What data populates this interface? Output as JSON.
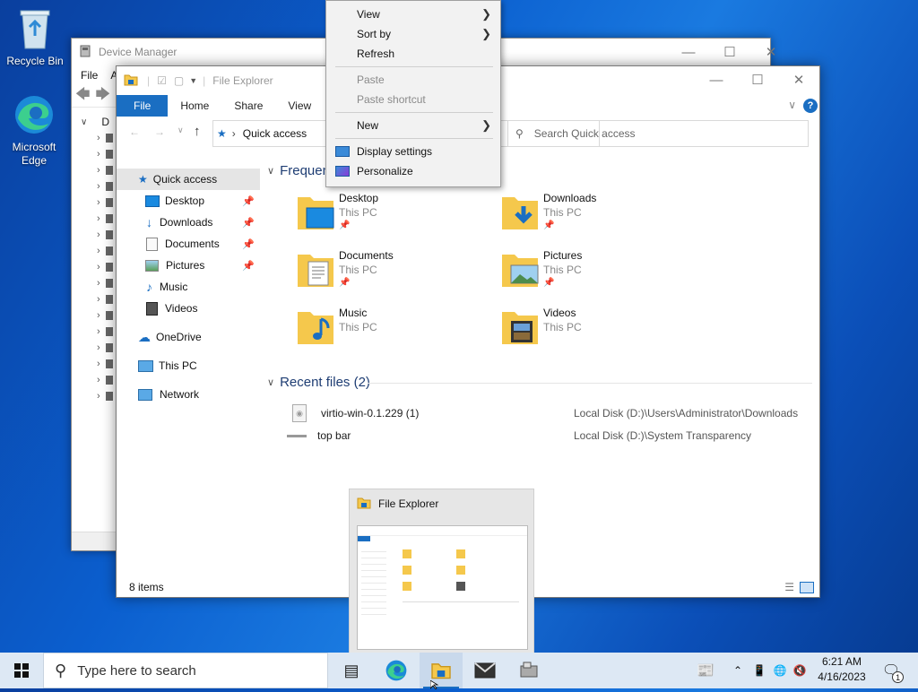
{
  "desktop": {
    "icons": [
      {
        "label": "Recycle Bin"
      },
      {
        "label": "Microsoft Edge"
      }
    ]
  },
  "device_manager": {
    "title": "Device Manager",
    "menu": [
      "File",
      "A"
    ],
    "tree_root": "D"
  },
  "explorer": {
    "title": "File Explorer",
    "tabs": [
      "File",
      "Home",
      "Share",
      "View"
    ],
    "address": "Quick access",
    "search_placeholder": "Search Quick access",
    "nav": [
      {
        "label": "Quick access",
        "pinned": false
      },
      {
        "label": "Desktop",
        "pinned": true
      },
      {
        "label": "Downloads",
        "pinned": true
      },
      {
        "label": "Documents",
        "pinned": true
      },
      {
        "label": "Pictures",
        "pinned": true
      },
      {
        "label": "Music",
        "pinned": false
      },
      {
        "label": "Videos",
        "pinned": false
      },
      {
        "label": "OneDrive",
        "pinned": false
      },
      {
        "label": "This PC",
        "pinned": false
      },
      {
        "label": "Network",
        "pinned": false
      }
    ],
    "frequent_header": "Frequen",
    "folders": [
      {
        "name": "Desktop",
        "location": "This PC",
        "pinned": true
      },
      {
        "name": "Downloads",
        "location": "This PC",
        "pinned": true
      },
      {
        "name": "Documents",
        "location": "This PC",
        "pinned": true
      },
      {
        "name": "Pictures",
        "location": "This PC",
        "pinned": true
      },
      {
        "name": "Music",
        "location": "This PC",
        "pinned": false
      },
      {
        "name": "Videos",
        "location": "This PC",
        "pinned": false
      }
    ],
    "recent_header": "Recent files (2)",
    "recent": [
      {
        "name": "virtio-win-0.1.229 (1)",
        "location": "Local Disk (D:)\\Users\\Administrator\\Downloads"
      },
      {
        "name": "top bar",
        "location": "Local Disk (D:)\\System Transparency"
      }
    ],
    "status": "8 items"
  },
  "context_menu": {
    "items": [
      {
        "label": "View",
        "submenu": true,
        "disabled": false
      },
      {
        "label": "Sort by",
        "submenu": true,
        "disabled": false
      },
      {
        "label": "Refresh",
        "submenu": false,
        "disabled": false
      },
      {
        "label": "Paste",
        "submenu": false,
        "disabled": true
      },
      {
        "label": "Paste shortcut",
        "submenu": false,
        "disabled": true
      },
      {
        "label": "New",
        "submenu": true,
        "disabled": false
      },
      {
        "label": "Display settings",
        "submenu": false,
        "disabled": false
      },
      {
        "label": "Personalize",
        "submenu": false,
        "disabled": false
      }
    ]
  },
  "thumbnail": {
    "title": "File Explorer"
  },
  "taskbar": {
    "search_placeholder": "Type here to search",
    "time": "6:21 AM",
    "date": "4/16/2023",
    "notification_count": "1"
  },
  "colors": {
    "accent": "#1a6ec2",
    "folder": "#f5c84c"
  }
}
